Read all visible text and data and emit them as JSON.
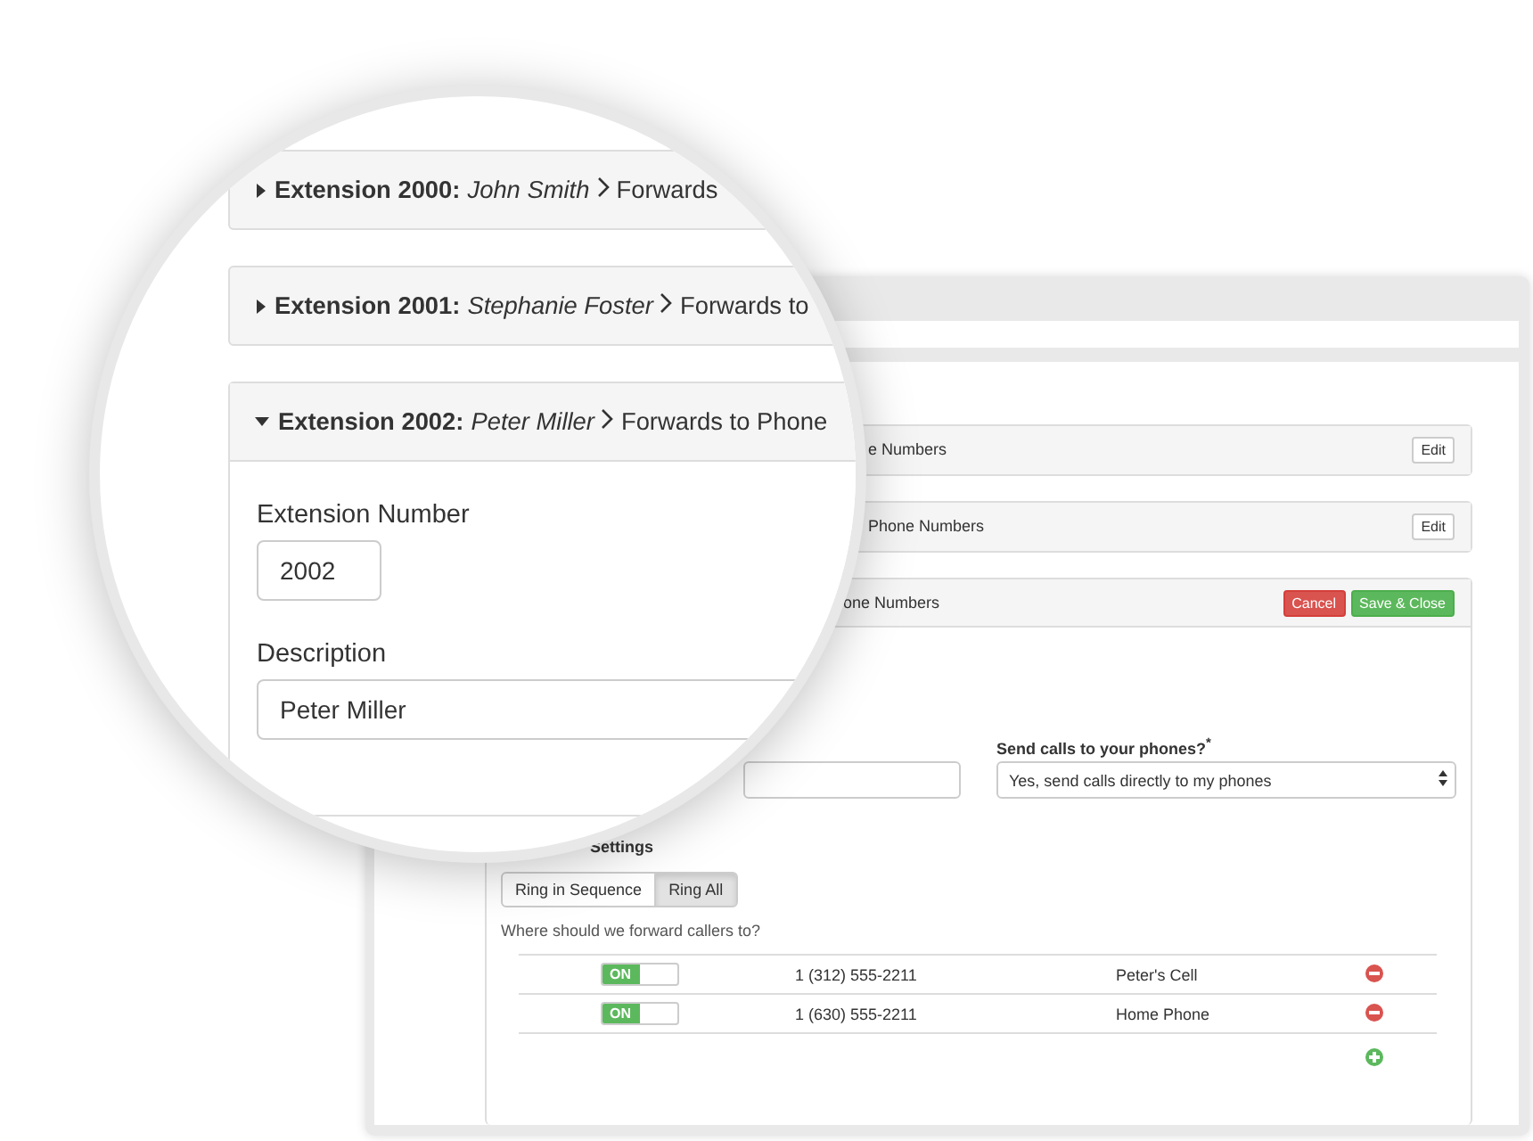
{
  "window": {
    "panels": [
      {
        "title": "e Numbers",
        "expanded": false,
        "buttons": [
          {
            "label": "Edit",
            "kind": "default"
          }
        ]
      },
      {
        "title": "Phone Numbers",
        "expanded": false,
        "buttons": [
          {
            "label": "Edit",
            "kind": "default"
          }
        ]
      },
      {
        "title": "one Numbers",
        "expanded": true,
        "buttons": [
          {
            "label": "Cancel",
            "kind": "danger"
          },
          {
            "label": "Save & Close",
            "kind": "success"
          }
        ],
        "form": {
          "send_calls": {
            "label": "Send calls to your phones?$^{*}$",
            "value": "Yes, send calls directly to my phones"
          },
          "ring_settings_label": "Settings",
          "ring_modes": [
            {
              "label": "Ring in Sequence",
              "selected": false
            },
            {
              "label": "Ring All",
              "selected": true
            }
          ],
          "forward_prompt": "Where should we forward callers to?",
          "destinations": [
            {
              "on": true,
              "toggle_label": "ON",
              "number": "1 (312) 555-2211",
              "name": "Peter's Cell"
            },
            {
              "on": true,
              "toggle_label": "ON",
              "number": "1 (630) 555-2211",
              "name": "Home Phone"
            }
          ]
        }
      }
    ]
  },
  "magnifier": {
    "extensions": [
      {
        "label": "Extension 2000:",
        "name": "John Smith",
        "destination": "Forwards",
        "expanded": false
      },
      {
        "label": "Extension 2001:",
        "name": "Stephanie Foster",
        "destination": "Forwards to",
        "expanded": false
      },
      {
        "label": "Extension 2002:",
        "name": "Peter Miller",
        "destination": "Forwards to Phone",
        "expanded": true,
        "fields": [
          {
            "label": "Extension Number",
            "value": "2002",
            "kind": "short"
          },
          {
            "label": "Description",
            "value": "Peter Miller",
            "kind": "wide"
          }
        ]
      }
    ]
  }
}
